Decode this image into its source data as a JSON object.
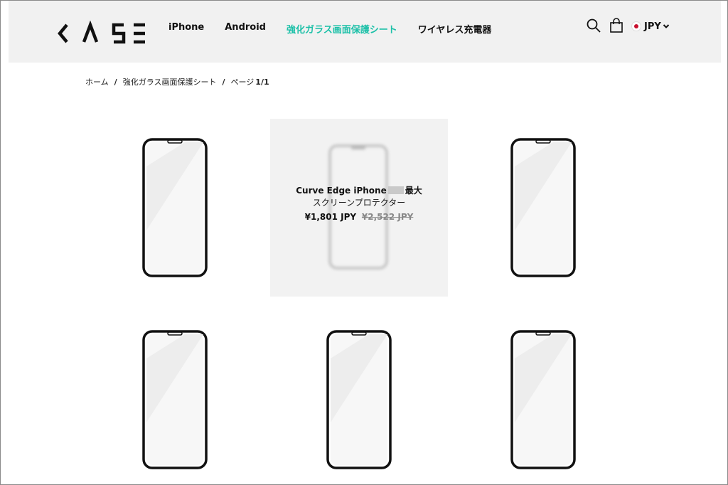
{
  "header": {
    "logo_alt": "CASE",
    "nav": [
      {
        "label": "iPhone"
      },
      {
        "label": "Android"
      },
      {
        "label": "強化ガラス画面保護シート"
      },
      {
        "label": "ワイヤレス充電器"
      }
    ],
    "currency": "JPY"
  },
  "breadcrumb": {
    "home": "ホーム",
    "category": "強化ガラス画面保護シート",
    "page_label": "ページ",
    "page_number": "1/1"
  },
  "hovered_product": {
    "title_prefix": "Curve Edge iPhone",
    "title_suffix": "最大",
    "subtitle": "スクリーンプロテクター",
    "price": "¥1,801 JPY",
    "compare_price": "¥2,522 JPY"
  },
  "colors": {
    "accent": "#1cc0a8",
    "header_bg": "#f1f1f1",
    "hover_bg": "#f2f2f2"
  }
}
